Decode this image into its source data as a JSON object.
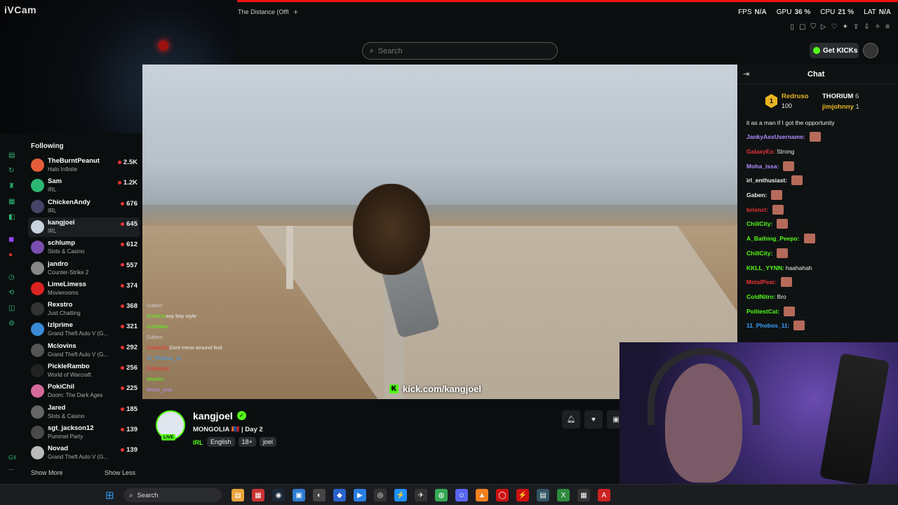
{
  "tab": {
    "title": "The Distance (Offl",
    "add_label": "+"
  },
  "stats": {
    "fps_label": "FPS",
    "fps": "N/A",
    "gpu_label": "GPU",
    "gpu": "36 %",
    "cpu_label": "CPU",
    "cpu": "21 %",
    "lat_label": "LAT",
    "lat": "N/A"
  },
  "ivcam": {
    "logo": "iVCam"
  },
  "search": {
    "placeholder": "Search"
  },
  "header": {
    "get_kicks": "Get KICKs"
  },
  "sidebar": {
    "title": "Following",
    "items": [
      {
        "name": "TheBurntPeanut",
        "category": "Halo Infinite",
        "viewers": "2.5K",
        "color": "#e35d3a"
      },
      {
        "name": "Sam",
        "category": "IRL",
        "viewers": "1.2K",
        "color": "#2bb673"
      },
      {
        "name": "ChickenAndy",
        "category": "IRL",
        "viewers": "676",
        "color": "#446"
      },
      {
        "name": "kangjoel",
        "category": "IRL",
        "viewers": "645",
        "color": "#c9d3df"
      },
      {
        "name": "schlump",
        "category": "Slots & Casino",
        "viewers": "612",
        "color": "#7a4fb0"
      },
      {
        "name": "jandro",
        "category": "Counter-Strike 2",
        "viewers": "557",
        "color": "#888"
      },
      {
        "name": "LimeLimess",
        "category": "Movierooms",
        "viewers": "374",
        "color": "#d22"
      },
      {
        "name": "Rexstro",
        "category": "Just Chatting",
        "viewers": "368",
        "color": "#333"
      },
      {
        "name": "Izlprime",
        "category": "Grand Theft Auto V (G...",
        "viewers": "321",
        "color": "#3a8ad6"
      },
      {
        "name": "Mclovins",
        "category": "Grand Theft Auto V (G...",
        "viewers": "292",
        "color": "#555"
      },
      {
        "name": "PickleRambo",
        "category": "World of Warcraft",
        "viewers": "256",
        "color": "#222"
      },
      {
        "name": "PokiChil",
        "category": "Doom: The Dark Ages",
        "viewers": "225",
        "color": "#d66a9a"
      },
      {
        "name": "Jared",
        "category": "Slots & Casino",
        "viewers": "185",
        "color": "#666"
      },
      {
        "name": "sgt_jackson12",
        "category": "Pummel Party",
        "viewers": "139",
        "color": "#4a4a4a"
      },
      {
        "name": "Novad",
        "category": "Grand Theft Auto V (G...",
        "viewers": "139",
        "color": "#bbb"
      }
    ],
    "show_more": "Show More",
    "show_less": "Show Less"
  },
  "video": {
    "watermark": "kick.com/kangjoel",
    "overlay_chat": [
      {
        "user": "Gaben",
        "text": ""
      },
      {
        "user": "licrolicro",
        "text": "soy boy style"
      },
      {
        "user": "ColdNitro",
        "text": ""
      },
      {
        "user": "Gaben",
        "text": ""
      },
      {
        "user": "GalaxyEx",
        "text": "Dont mess around fool"
      },
      {
        "user": "11_Phobos_11",
        "text": ""
      },
      {
        "user": "PoliteKatt",
        "text": ""
      },
      {
        "user": "NiveKn",
        "text": ""
      },
      {
        "user": "Moha_issa",
        "text": ""
      }
    ]
  },
  "stream": {
    "name": "kangjoel",
    "live": "LIVE",
    "title": "MONGOLIA 🇲🇳 | Day 2",
    "category": "IRL",
    "tags": [
      "English",
      "18+",
      "joel"
    ]
  },
  "chat": {
    "title": "Chat",
    "pinned": {
      "gifter1": "Redruso",
      "gifter1_count": "100",
      "gifter2": "THORIUM",
      "gifter2_count": "6",
      "gifter3": "jimjohnny",
      "gifter3_count": "1"
    },
    "wrapped_text": "it as a man if I got the opportunity",
    "messages": [
      {
        "user": "JankyAssUsername:",
        "text": "",
        "color": "#b48bff",
        "emote": true
      },
      {
        "user": "GalaxyEx:",
        "text": "Strong",
        "color": "#e33",
        "emote": false
      },
      {
        "user": "Moha_issa:",
        "text": "",
        "color": "#b48bff",
        "emote": true
      },
      {
        "user": "irl_enthusiast:",
        "text": "",
        "color": "#eee",
        "emote": true
      },
      {
        "user": "Gaben:",
        "text": "",
        "color": "#eee",
        "emote": true
      },
      {
        "user": "brisncl:",
        "text": "",
        "color": "#e33",
        "emote": true
      },
      {
        "user": "ChillCity:",
        "text": "",
        "color": "#53fc18",
        "emote": true
      },
      {
        "user": "A_Bathing_Peepo:",
        "text": "",
        "color": "#53fc18",
        "emote": true
      },
      {
        "user": "ChillCity:",
        "text": "",
        "color": "#53fc18",
        "emote": true
      },
      {
        "user": "KKLL_YYNN:",
        "text": "haahahah",
        "color": "#53fc18",
        "emote": false
      },
      {
        "user": "MetalPear:",
        "text": "",
        "color": "#e33",
        "emote": true
      },
      {
        "user": "ColdNitro:",
        "text": "Bro",
        "color": "#53fc18",
        "emote": false
      },
      {
        "user": "PolitestCat:",
        "text": "",
        "color": "#53fc18",
        "emote": true
      },
      {
        "user": "11_Phobos_11:",
        "text": "",
        "color": "#3aa0ff",
        "emote": true
      }
    ]
  },
  "taskbar": {
    "search_label": "Search"
  },
  "colors": {
    "accent": "#53fc18",
    "bg": "#0b0e0f",
    "chat_bg": "#0f1213"
  }
}
